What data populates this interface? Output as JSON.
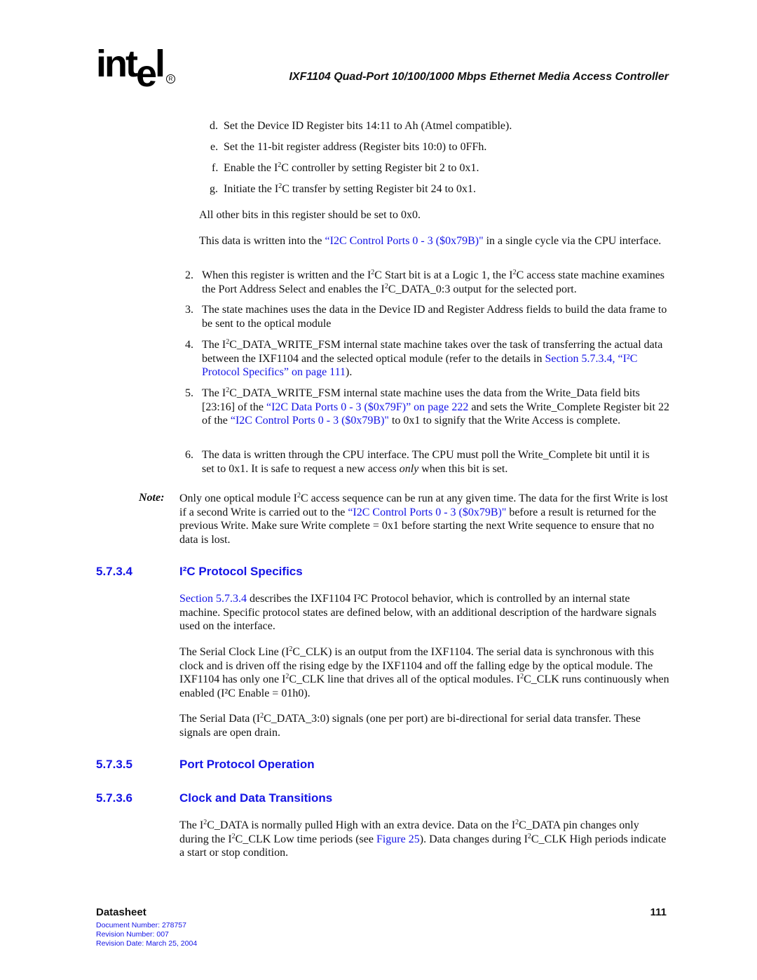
{
  "header": {
    "logo_text": "int",
    "logo_e": "e",
    "logo_l": "l",
    "logo_reg": "R",
    "title": "IXF1104 Quad-Port 10/100/1000 Mbps Ethernet Media Access Controller"
  },
  "sublist": [
    {
      "marker": "d.",
      "text": "Set the Device ID Register bits 14:11 to Ah (Atmel compatible)."
    },
    {
      "marker": "e.",
      "text": "Set the 11-bit register address (Register bits 10:0) to 0FFh."
    },
    {
      "marker": "f.",
      "pre": "Enable the I",
      "sup": "2",
      "post": "C controller by setting Register bit 2 to 0x1."
    },
    {
      "marker": "g.",
      "pre": "Initiate the I",
      "sup": "2",
      "post": "C transfer by setting Register bit 24 to 0x1."
    }
  ],
  "para_all_other": "All other bits in this register should be set to 0x0.",
  "para_written": {
    "pre": "This data is written into the ",
    "link": "“I2C Control Ports 0 - 3 ($0x79B)\"",
    "post": " in a single cycle via the CPU interface."
  },
  "steps": [
    {
      "marker": "2.",
      "parts": [
        "When this register is written and the I",
        "2",
        "C Start bit is at a Logic 1, the I",
        "2",
        "C access state machine examines the Port Address Select and enables the I",
        "2",
        "C_DATA_0:3 output for the selected port."
      ]
    },
    {
      "marker": "3.",
      "text": "The state machines uses the data in the Device ID and Register Address fields to build the data frame to be sent to the optical module"
    },
    {
      "marker": "4.",
      "pre": "The I",
      "sup": "2",
      "mid": "C_DATA_WRITE_FSM internal state machine takes over the task of transferring the actual data between the IXF1104 and the selected optical module (refer to the details in ",
      "link": "Section 5.7.3.4, “I²C Protocol Specifics” on page 111",
      "post": ")."
    },
    {
      "marker": "5.",
      "pre": "The I",
      "sup": "2",
      "mid": "C_DATA_WRITE_FSM internal state machine uses the data from the Write_Data field bits [23:16] of the ",
      "link1": "“I2C Data Ports 0 - 3 ($0x79F)” on page 222",
      "mid2": " and sets the Write_Complete Register bit 22 of the ",
      "link2": "“I2C Control Ports 0 - 3 ($0x79B)\"",
      "post": " to 0x1 to signify that the Write Access is complete."
    },
    {
      "marker": "6.",
      "pre": "The data is written through the CPU interface. The CPU must poll the Write_Complete bit until it is set to 0x1. It is safe to request a new access ",
      "em": "only",
      "post": " when this bit is set."
    }
  ],
  "note": {
    "label": "Note:",
    "pre": "Only one optical module I",
    "sup": "2",
    "mid": "C access sequence can be run at any given time. The data for the first Write is lost if a second Write is carried out to the ",
    "link": "“I2C Control Ports 0 - 3 ($0x79B)\"",
    "post": " before a result is returned for the previous Write. Make sure Write complete = 0x1 before starting the next Write sequence to ensure that no data is lost."
  },
  "section_5734": {
    "number": "5.7.3.4",
    "title": "I²C Protocol Specifics",
    "p1_link": "Section 5.7.3.4",
    "p1_text": " describes the IXF1104 I²C Protocol behavior, which is controlled by an internal state machine. Specific protocol states are defined below, with an additional description of the hardware signals used on the interface.",
    "p2": [
      "The Serial Clock Line (I",
      "2",
      "C_CLK) is an output from the IXF1104. The serial data is synchronous with this clock and is driven off the rising edge by the IXF1104 and off the falling edge by the optical module. The IXF1104 has only one I",
      "2",
      "C_CLK line that drives all of the optical modules. I",
      "2",
      "C_CLK runs continuously when enabled (I²C Enable = 01h0)."
    ],
    "p3": [
      "The Serial Data (I",
      "2",
      "C_DATA_3:0) signals (one per port) are bi-directional for serial data transfer. These signals are open drain."
    ]
  },
  "section_5735": {
    "number": "5.7.3.5",
    "title": "Port Protocol Operation"
  },
  "section_5736": {
    "number": "5.7.3.6",
    "title": "Clock and Data Transitions",
    "p1": [
      "The I",
      "2",
      "C_DATA is normally pulled High with an extra device. Data on the I",
      "2",
      "C_DATA pin changes only during the I",
      "2",
      "C_CLK Low time periods (see "
    ],
    "link": "Figure 25",
    "p1_post": [
      "). Data changes during I",
      "2",
      "C_CLK High periods indicate a start or stop condition."
    ]
  },
  "footer": {
    "label": "Datasheet",
    "page": "111",
    "doc_number": "Document Number: 278757",
    "revision_number": "Revision Number: 007",
    "revision_date": "Revision Date: March 25, 2004"
  }
}
